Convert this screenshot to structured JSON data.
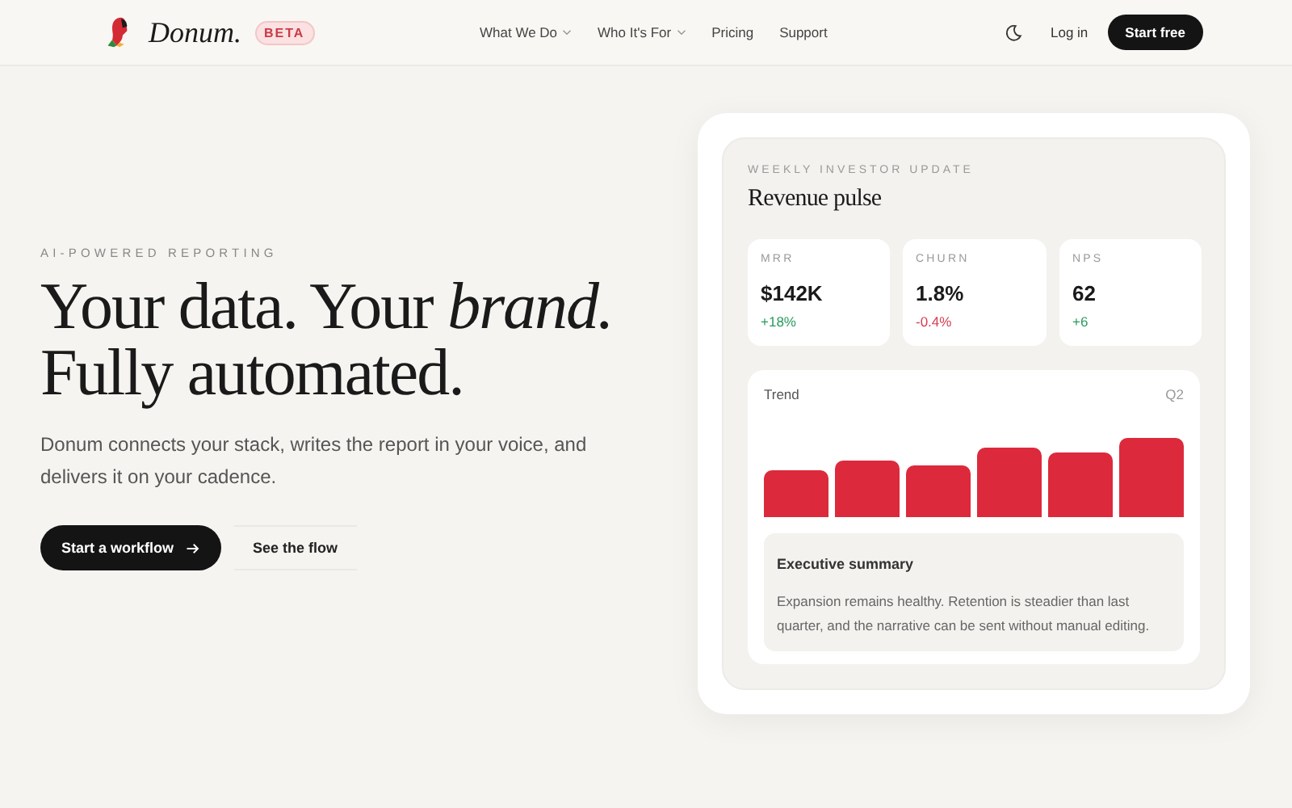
{
  "brand": {
    "name": "Donum.",
    "badge": "BETA"
  },
  "nav": [
    {
      "label": "What We Do",
      "dropdown": true
    },
    {
      "label": "Who It's For",
      "dropdown": true
    },
    {
      "label": "Pricing",
      "dropdown": false
    },
    {
      "label": "Support",
      "dropdown": false
    }
  ],
  "header_actions": {
    "login": "Log in",
    "cta": "Start free"
  },
  "hero": {
    "eyebrow": "AI-POWERED REPORTING",
    "headline_line1": "Your data. Your *brand.*",
    "headline_line2": "Fully automated.",
    "body": "Donum connects your stack, writes the report in your voice, and delivers it on your cadence.",
    "primary_button": "Start a workflow",
    "secondary_button": "See the flow"
  },
  "report": {
    "eyebrow": "WEEKLY INVESTOR UPDATE",
    "title": "Revenue pulse",
    "metrics": [
      {
        "label": "MRR",
        "value": "$142K",
        "change": "+18%",
        "color": "#2a9a60"
      },
      {
        "label": "CHURN",
        "value": "1.8%",
        "change": "-0.4%",
        "color": "#d43d52"
      },
      {
        "label": "NPS",
        "value": "62",
        "change": "+6",
        "color": "#2a9a60"
      }
    ],
    "trend": {
      "title": "Trend",
      "period": "Q2"
    },
    "summary": {
      "title": "Executive summary",
      "text": "Expansion remains healthy. Retention is steadier than last quarter, and the narrative can be sent without manual editing."
    }
  }
}
